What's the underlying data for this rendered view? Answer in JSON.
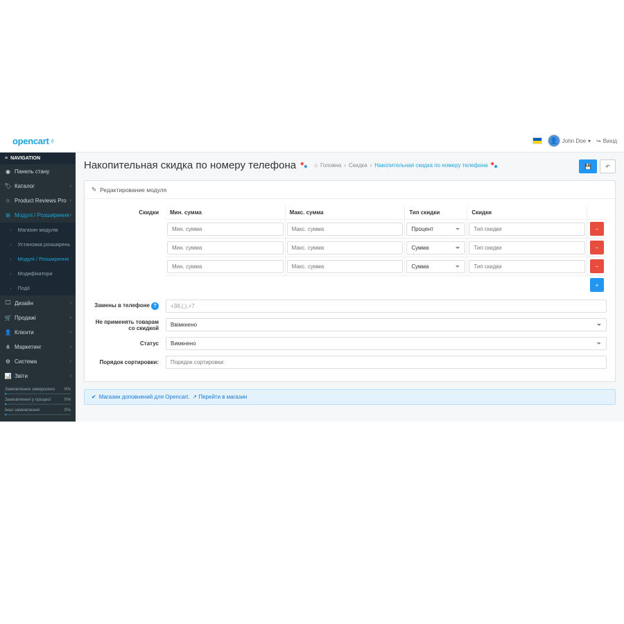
{
  "header": {
    "logo": "opencart",
    "user": "John Doe",
    "logout": "Вихід"
  },
  "sidebar": {
    "nav_label": "NAVIGATION",
    "items": [
      "Панель стану",
      "Каталог",
      "Product Reviews Pro",
      "Модулі / Розширення",
      "Дизайн",
      "Продажі",
      "Клієнти",
      "Маркетинг",
      "Система",
      "Звіти"
    ],
    "sub": [
      "Магазин модулів",
      "Установка розширень",
      "Модулі / Розширення",
      "Модифікатори",
      "Події"
    ],
    "stats": [
      {
        "label": "Замовлення завершено",
        "value": "0%"
      },
      {
        "label": "Замовлення у процесі",
        "value": "0%"
      },
      {
        "label": "Інші замовлення",
        "value": "0%"
      }
    ]
  },
  "page": {
    "title": "Накопительная скидка по номеру телефона",
    "breadcrumb": [
      "Головна",
      "Скидка",
      "Накопительная скидка по номеру телефона"
    ]
  },
  "panel": {
    "title": "Редактирование модуля"
  },
  "form": {
    "discounts_label": "Скидки",
    "cols": [
      "Мин. сумма",
      "Макс. сумма",
      "Тип скидки",
      "Скидки"
    ],
    "rows": [
      {
        "min_ph": "Мин. сумма",
        "max_ph": "Макс. сумма",
        "type": "Процент",
        "disc_ph": "Тип скидки"
      },
      {
        "min_ph": "Мин. сумма",
        "max_ph": "Макс. сумма",
        "type": "Сумма",
        "disc_ph": "Тип скидки"
      },
      {
        "min_ph": "Мин. сумма",
        "max_ph": "Макс. сумма",
        "type": "Сумма",
        "disc_ph": "Тип скидки"
      }
    ],
    "phone_replace_label": "Замены в телефоне",
    "phone_replace_value": "+38,(,),+7",
    "exclude_label": "Не применять товарам со скидкой",
    "exclude_value": "Ввімкнено",
    "status_label": "Статус",
    "status_value": "Вимкнено",
    "sort_label": "Порядок сортировки:",
    "sort_placeholder": "Порядок сортировки:"
  },
  "footer": {
    "info_text": "Магазин доповнений для Opencart.",
    "link_text": "Перейти в магазин"
  }
}
